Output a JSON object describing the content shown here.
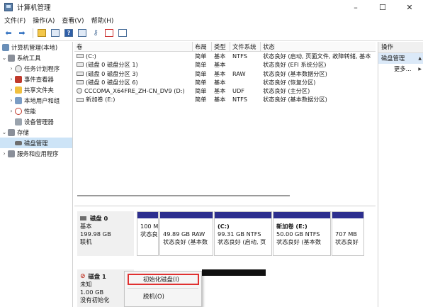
{
  "window": {
    "title": "计算机管理",
    "minimize_label": "–",
    "maximize_label": "☐",
    "close_label": "✕"
  },
  "menubar": {
    "items": [
      "文件(F)",
      "操作(A)",
      "查看(V)",
      "帮助(H)"
    ]
  },
  "toolbar": {
    "icons": [
      "back-icon",
      "forward-icon",
      "up-folder-icon",
      "show-hide-tree-icon",
      "help-icon",
      "properties-icon",
      "key-icon",
      "check-icon",
      "panel-icon"
    ]
  },
  "tree": {
    "root": "计算机管理(本地)",
    "system_tools": "系统工具",
    "task_scheduler": "任务计划程序",
    "event_viewer": "事件查看器",
    "shared_folders": "共享文件夹",
    "local_users": "本地用户和组",
    "performance": "性能",
    "device_manager": "设备管理器",
    "storage": "存储",
    "disk_management": "磁盘管理",
    "services_apps": "服务和应用程序"
  },
  "volumes": {
    "headers": [
      "卷",
      "布局",
      "类型",
      "文件系统",
      "状态"
    ],
    "rows": [
      {
        "volume": "(C:)",
        "layout": "简单",
        "type": "基本",
        "fs": "NTFS",
        "status": "状态良好 (启动, 页面文件, 故障转储, 基本"
      },
      {
        "volume": "(磁盘 0 磁盘分区 1)",
        "layout": "简单",
        "type": "基本",
        "fs": "",
        "status": "状态良好 (EFI 系统分区)"
      },
      {
        "volume": "(磁盘 0 磁盘分区 3)",
        "layout": "简单",
        "type": "基本",
        "fs": "RAW",
        "status": "状态良好 (基本数据分区)"
      },
      {
        "volume": "(磁盘 0 磁盘分区 6)",
        "layout": "简单",
        "type": "基本",
        "fs": "",
        "status": "状态良好 (恢复分区)"
      },
      {
        "volume": "CCCOMA_X64FRE_ZH-CN_DV9 (D:)",
        "layout": "简单",
        "type": "基本",
        "fs": "UDF",
        "status": "状态良好 (主分区)"
      },
      {
        "volume": "新加卷 (E:)",
        "layout": "简单",
        "type": "基本",
        "fs": "NTFS",
        "status": "状态良好 (基本数据分区)"
      }
    ]
  },
  "actions": {
    "title": "操作",
    "section": "磁盘管理",
    "more": "更多..."
  },
  "disks": {
    "disk0": {
      "name": "磁盘 0",
      "type": "基本",
      "size": "199.98 GB",
      "state": "联机",
      "partitions": [
        {
          "line1": "100 M",
          "line2": "状态良"
        },
        {
          "line1": "49.89 GB RAW",
          "line2": "状态良好 (基本数"
        },
        {
          "title": "(C:)",
          "line1": "99.31 GB NTFS",
          "line2": "状态良好 (启动, 页"
        },
        {
          "title": "新加卷 (E:)",
          "line1": "50.00 GB NTFS",
          "line2": "状态良好 (基本数"
        },
        {
          "line1": "707 MB",
          "line2": "状态良好"
        }
      ]
    },
    "disk1": {
      "name": "磁盘 1",
      "type": "未知",
      "size": "1.00 GB",
      "state": "没有初始化"
    }
  },
  "context_menu": {
    "items": [
      "初始化磁盘(I)",
      "脱机(O)"
    ]
  },
  "colors": {
    "partition_stripe": "#2d2f8f",
    "unallocated_stripe": "#111111",
    "highlight_border": "#e03030",
    "selection": "#cde4f7"
  }
}
